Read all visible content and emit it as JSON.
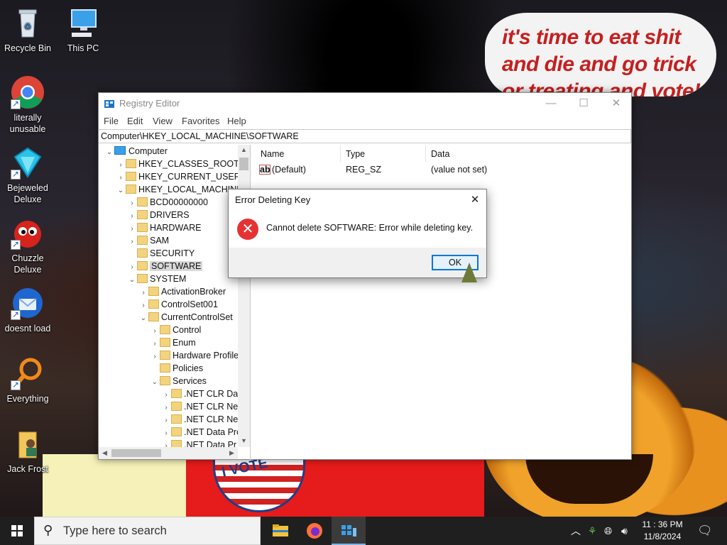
{
  "wallpaper": {
    "bubble_text": "it's time to eat shit and die and go trick or treating and vote!",
    "badge_text": "I VOTE"
  },
  "desktop_icons": [
    {
      "label": "Recycle Bin",
      "icon": "recycle-bin-icon"
    },
    {
      "label": "This PC",
      "icon": "this-pc-icon"
    },
    {
      "label": "literally unusable",
      "icon": "chrome-icon"
    },
    {
      "label": "Bejeweled Deluxe",
      "icon": "bejeweled-icon"
    },
    {
      "label": "Chuzzle Deluxe",
      "icon": "chuzzle-icon"
    },
    {
      "label": "doesnt load",
      "icon": "thunderbird-icon"
    },
    {
      "label": "Everything",
      "icon": "everything-search-icon"
    },
    {
      "label": "Jack Frost",
      "icon": "jack-frost-folder-icon"
    }
  ],
  "regedit": {
    "title": "Registry Editor",
    "menu": [
      "File",
      "Edit",
      "View",
      "Favorites",
      "Help"
    ],
    "address": "Computer\\HKEY_LOCAL_MACHINE\\SOFTWARE",
    "tree": [
      {
        "label": "Computer",
        "level": 0,
        "state": "expanded"
      },
      {
        "label": "HKEY_CLASSES_ROOT",
        "level": 1,
        "state": "collapsed"
      },
      {
        "label": "HKEY_CURRENT_USER",
        "level": 1,
        "state": "collapsed"
      },
      {
        "label": "HKEY_LOCAL_MACHINE",
        "level": 1,
        "state": "expanded"
      },
      {
        "label": "BCD00000000",
        "level": 2,
        "state": "collapsed"
      },
      {
        "label": "DRIVERS",
        "level": 2,
        "state": "collapsed"
      },
      {
        "label": "HARDWARE",
        "level": 2,
        "state": "collapsed"
      },
      {
        "label": "SAM",
        "level": 2,
        "state": "collapsed"
      },
      {
        "label": "SECURITY",
        "level": 2,
        "state": "leaf"
      },
      {
        "label": "SOFTWARE",
        "level": 2,
        "state": "collapsed",
        "selected": true
      },
      {
        "label": "SYSTEM",
        "level": 2,
        "state": "expanded"
      },
      {
        "label": "ActivationBroker",
        "level": 3,
        "state": "collapsed"
      },
      {
        "label": "ControlSet001",
        "level": 3,
        "state": "collapsed"
      },
      {
        "label": "CurrentControlSet",
        "level": 3,
        "state": "expanded"
      },
      {
        "label": "Control",
        "level": 4,
        "state": "collapsed"
      },
      {
        "label": "Enum",
        "level": 4,
        "state": "collapsed"
      },
      {
        "label": "Hardware Profile",
        "level": 4,
        "state": "collapsed"
      },
      {
        "label": "Policies",
        "level": 4,
        "state": "leaf"
      },
      {
        "label": "Services",
        "level": 4,
        "state": "expanded"
      },
      {
        "label": ".NET CLR Dat",
        "level": 5,
        "state": "collapsed"
      },
      {
        "label": ".NET CLR Net",
        "level": 5,
        "state": "collapsed"
      },
      {
        "label": ".NET CLR Net",
        "level": 5,
        "state": "collapsed"
      },
      {
        "label": ".NET Data Pro",
        "level": 5,
        "state": "collapsed"
      },
      {
        "label": ".NET Data Pr",
        "level": 5,
        "state": "collapsed"
      }
    ],
    "list": {
      "columns": [
        "Name",
        "Type",
        "Data"
      ],
      "rows": [
        {
          "name": "(Default)",
          "type": "REG_SZ",
          "data": "(value not set)"
        }
      ]
    }
  },
  "dialog": {
    "title": "Error Deleting Key",
    "message": "Cannot delete SOFTWARE:  Error while deleting key.",
    "ok_label": "OK"
  },
  "taskbar": {
    "search_placeholder": "Type here to search",
    "apps": [
      "file-explorer-icon",
      "firefox-icon",
      "registry-editor-icon"
    ],
    "time": "11 : 36 PM",
    "date": "11/8/2024"
  }
}
